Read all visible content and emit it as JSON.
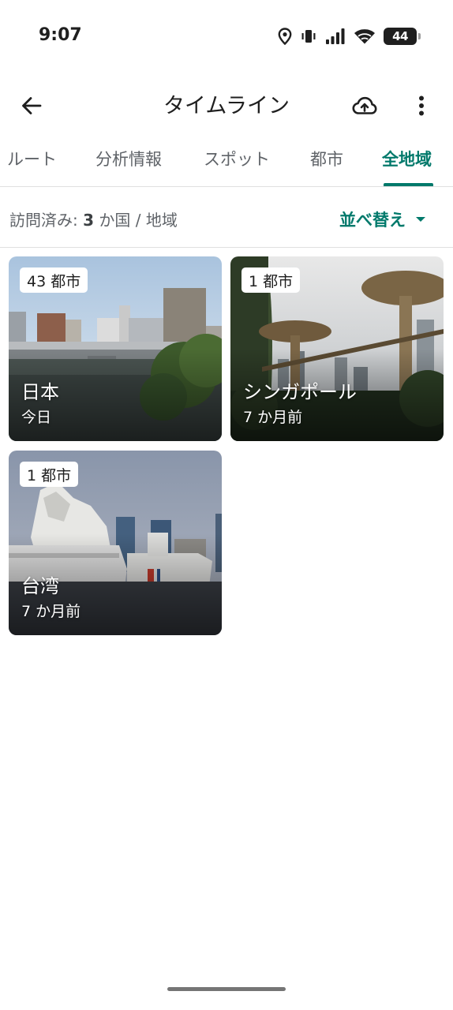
{
  "status_bar": {
    "time": "9:07",
    "battery_level": "44",
    "icons": [
      "location-icon",
      "vibrate-icon",
      "signal-icon",
      "wifi-icon",
      "battery-icon"
    ]
  },
  "app_bar": {
    "title": "タイムライン",
    "icons": [
      "back-arrow-icon",
      "cloud-upload-icon",
      "more-vert-icon"
    ]
  },
  "tabs": [
    {
      "label": "ルート",
      "active": false
    },
    {
      "label": "分析情報",
      "active": false
    },
    {
      "label": "スポット",
      "active": false
    },
    {
      "label": "都市",
      "active": false
    },
    {
      "label": "全地域",
      "active": true
    }
  ],
  "summary": {
    "prefix": "訪問済み: ",
    "count": "3",
    "suffix": " か国 / 地域",
    "sort_label": "並べ替え"
  },
  "regions": [
    {
      "name": "日本",
      "cities": "43 都市",
      "last_visit": "今日"
    },
    {
      "name": "シンガポール",
      "cities": "1 都市",
      "last_visit": "7 か月前"
    },
    {
      "name": "台湾",
      "cities": "1 都市",
      "last_visit": "7 か月前"
    }
  ],
  "colors": {
    "accent": "#00796b",
    "text_primary": "#1f1f1f",
    "text_secondary": "#5f6368"
  }
}
